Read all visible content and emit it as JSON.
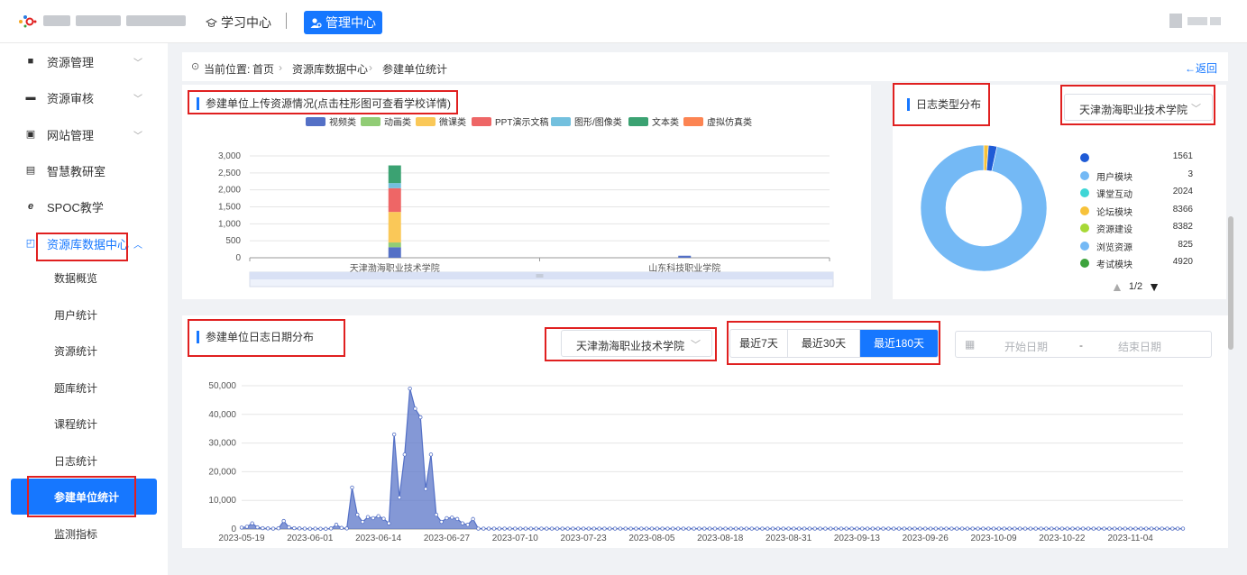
{
  "topbar": {
    "nav_learning": "学习中心",
    "nav_admin": "管理中心"
  },
  "sidebar": {
    "items": [
      {
        "label": "资源管理"
      },
      {
        "label": "资源审核"
      },
      {
        "label": "网站管理"
      },
      {
        "label": "智慧教研室"
      },
      {
        "label": "SPOC教学"
      },
      {
        "label": "资源库数据中心"
      }
    ],
    "sub_items": [
      {
        "label": "数据概览"
      },
      {
        "label": "用户统计"
      },
      {
        "label": "资源统计"
      },
      {
        "label": "题库统计"
      },
      {
        "label": "课程统计"
      },
      {
        "label": "日志统计"
      },
      {
        "label": "参建单位统计"
      },
      {
        "label": "监测指标"
      }
    ]
  },
  "breadcrumb": {
    "prefix": "当前位置:",
    "items": [
      "首页",
      "资源库数据中心",
      "参建单位统计"
    ],
    "back": "←返回"
  },
  "upload_panel": {
    "title": "参建单位上传资源情况(点击柱形图可查看学校详情)"
  },
  "log_type_panel": {
    "title": "日志类型分布",
    "select_value": "天津渤海职业技术学院",
    "legend": [
      {
        "name": "",
        "value": "1561",
        "color": "#1f5bd6"
      },
      {
        "name": "用户模块",
        "value": "3",
        "color": "#74b9f5"
      },
      {
        "name": "课堂互动",
        "value": "2024",
        "color": "#3ed6d6"
      },
      {
        "name": "论坛模块",
        "value": "8366",
        "color": "#f7c23a"
      },
      {
        "name": "资源建设",
        "value": "8382",
        "color": "#a7d936"
      },
      {
        "name": "浏览资源",
        "value": "825",
        "color": "#74b9f5"
      },
      {
        "name": "考试模块",
        "value": "4920",
        "color": "#3da33d"
      }
    ],
    "pager": "1/2",
    "pager_up": "▲",
    "pager_down": "▼"
  },
  "date_panel": {
    "title": "参建单位日志日期分布",
    "select_value": "天津渤海职业技术学院",
    "ranges": [
      "最近7天",
      "最近30天",
      "最近180天"
    ],
    "active_range": "最近180天",
    "start_placeholder": "开始日期",
    "end_placeholder": "结束日期",
    "range_sep": "-"
  },
  "chart_data": [
    {
      "type": "bar",
      "stacked": true,
      "categories": [
        "天津渤海职业技术学院",
        "山东科技职业学院"
      ],
      "series": [
        {
          "name": "视频类",
          "color": "#5470c6",
          "values": [
            310,
            60
          ]
        },
        {
          "name": "动画类",
          "color": "#91cc75",
          "values": [
            140,
            0
          ]
        },
        {
          "name": "微课类",
          "color": "#fac858",
          "values": [
            900,
            0
          ]
        },
        {
          "name": "PPT演示文稿",
          "color": "#ee6666",
          "values": [
            700,
            0
          ]
        },
        {
          "name": "图形/图像类",
          "color": "#73c0de",
          "values": [
            150,
            0
          ]
        },
        {
          "name": "文本类",
          "color": "#3ba272",
          "values": [
            520,
            0
          ]
        },
        {
          "name": "虚拟仿真类",
          "color": "#fc8452",
          "values": [
            0,
            0
          ]
        }
      ],
      "yticks": [
        "0",
        "500",
        "1,000",
        "1,500",
        "2,000",
        "2,500",
        "3,000"
      ],
      "ylim": [
        0,
        3000
      ],
      "legend": "top"
    },
    {
      "type": "area",
      "color": "#5470c6",
      "x_labels": [
        "2023-05-19",
        "2023-06-01",
        "2023-06-14",
        "2023-06-27",
        "2023-07-10",
        "2023-07-23",
        "2023-08-05",
        "2023-08-18",
        "2023-08-31",
        "2023-09-13",
        "2023-09-26",
        "2023-10-09",
        "2023-10-22",
        "2023-11-04"
      ],
      "yticks": [
        "0",
        "10,000",
        "20,000",
        "30,000",
        "40,000",
        "50,000"
      ],
      "ylim": [
        0,
        50000
      ],
      "start_date": "2023-05-19",
      "num_days": 180,
      "values": [
        500,
        800,
        2000,
        600,
        300,
        200,
        150,
        250,
        2800,
        600,
        300,
        200,
        150,
        100,
        150,
        100,
        80,
        200,
        1500,
        400,
        200,
        14500,
        5000,
        2500,
        4200,
        3800,
        4500,
        3600,
        2000,
        33000,
        11000,
        26000,
        49000,
        42000,
        39000,
        14000,
        26000,
        5000,
        2500,
        3800,
        4000,
        3500,
        2000,
        1500,
        3500
      ]
    }
  ]
}
